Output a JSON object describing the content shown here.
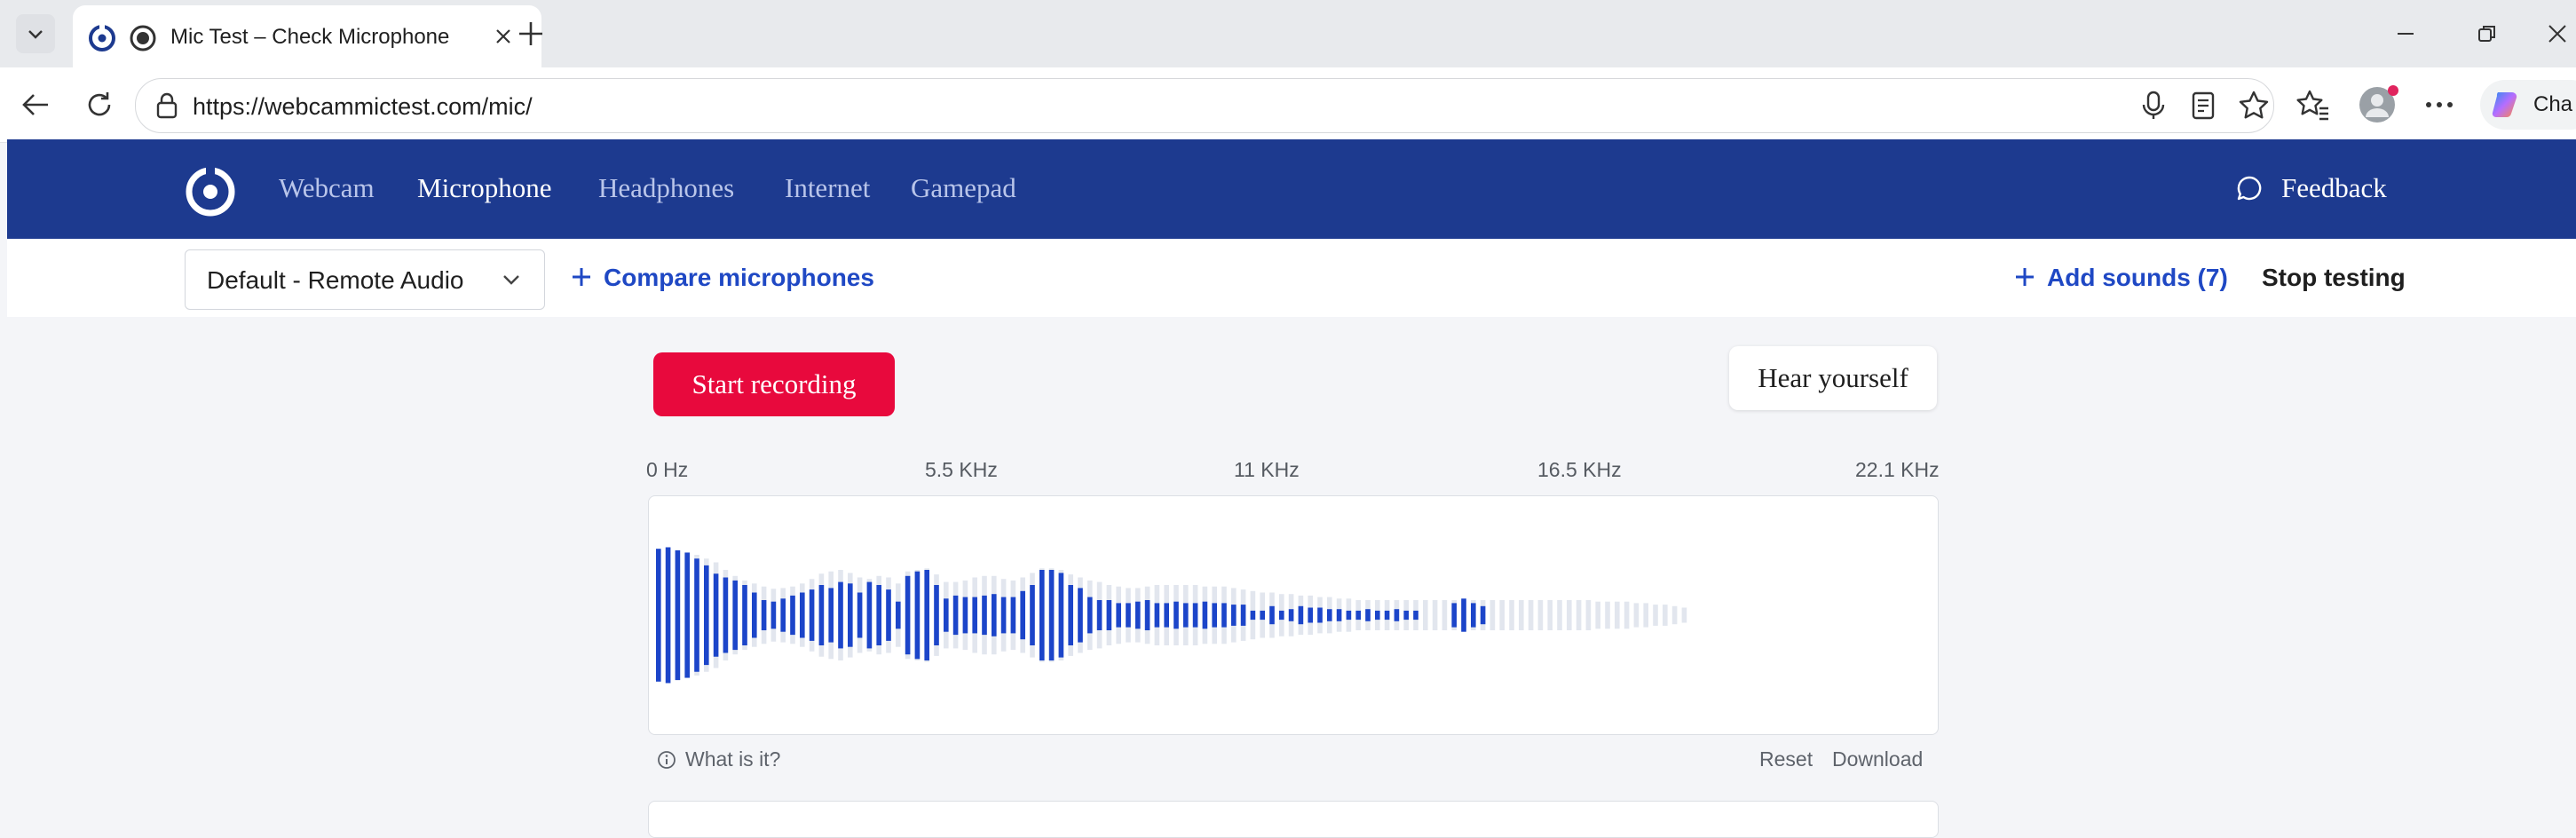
{
  "browser": {
    "tab_title": "Mic Test – Check Microphone",
    "url": "https://webcammictest.com/mic/",
    "copilot_label": "Cha"
  },
  "site": {
    "nav": [
      "Webcam",
      "Microphone",
      "Headphones",
      "Internet",
      "Gamepad"
    ],
    "active_nav": "Microphone",
    "feedback": "Feedback"
  },
  "toolbar": {
    "device": "Default - Remote Audio",
    "compare": "Compare microphones",
    "add_sounds": "Add sounds (7)",
    "stop": "Stop testing"
  },
  "main": {
    "record": "Start recording",
    "hear": "Hear yourself",
    "freq_ticks": [
      "0 Hz",
      "5.5 KHz",
      "11 KHz",
      "16.5 KHz",
      "22.1 KHz"
    ],
    "what_is_it": "What is it?",
    "reset": "Reset",
    "download": "Download"
  },
  "spectrum": {
    "active_color": "#1c45c9",
    "ghost_color": "#e2e6ee",
    "active": [
      0.88,
      0.9,
      0.86,
      0.83,
      0.75,
      0.66,
      0.55,
      0.5,
      0.46,
      0.4,
      0.3,
      0.2,
      0.18,
      0.22,
      0.26,
      0.3,
      0.34,
      0.4,
      0.36,
      0.44,
      0.42,
      0.3,
      0.44,
      0.4,
      0.34,
      0.18,
      0.52,
      0.58,
      0.6,
      0.4,
      0.22,
      0.26,
      0.24,
      0.24,
      0.26,
      0.28,
      0.24,
      0.24,
      0.32,
      0.4,
      0.6,
      0.6,
      0.56,
      0.4,
      0.36,
      0.24,
      0.2,
      0.2,
      0.16,
      0.16,
      0.18,
      0.2,
      0.16,
      0.16,
      0.18,
      0.16,
      0.16,
      0.18,
      0.16,
      0.16,
      0.14,
      0.14,
      0.06,
      0.06,
      0.12,
      0.06,
      0.08,
      0.12,
      0.1,
      0.1,
      0.08,
      0.08,
      0.06,
      0.06,
      0.08,
      0.06,
      0.06,
      0.08,
      0.06,
      0.06,
      0,
      0,
      0,
      0.16,
      0.22,
      0.16,
      0.12
    ],
    "ghost": [
      0.88,
      0.9,
      0.86,
      0.83,
      0.8,
      0.75,
      0.7,
      0.6,
      0.52,
      0.46,
      0.42,
      0.38,
      0.35,
      0.36,
      0.38,
      0.42,
      0.48,
      0.55,
      0.58,
      0.6,
      0.56,
      0.5,
      0.48,
      0.52,
      0.5,
      0.42,
      0.58,
      0.6,
      0.62,
      0.54,
      0.44,
      0.44,
      0.46,
      0.5,
      0.52,
      0.52,
      0.48,
      0.46,
      0.5,
      0.56,
      0.62,
      0.62,
      0.6,
      0.54,
      0.5,
      0.46,
      0.44,
      0.4,
      0.38,
      0.36,
      0.36,
      0.38,
      0.4,
      0.4,
      0.4,
      0.4,
      0.4,
      0.38,
      0.38,
      0.38,
      0.36,
      0.34,
      0.32,
      0.3,
      0.3,
      0.28,
      0.28,
      0.26,
      0.26,
      0.24,
      0.24,
      0.22,
      0.22,
      0.2,
      0.2,
      0.2,
      0.2,
      0.2,
      0.2,
      0.2,
      0.2,
      0.2,
      0.2,
      0.2,
      0.2,
      0.2,
      0.2,
      0.2,
      0.2,
      0.2,
      0.2,
      0.2,
      0.2,
      0.2,
      0.2,
      0.2,
      0.2,
      0.2,
      0.18,
      0.18,
      0.18,
      0.18,
      0.16,
      0.16,
      0.14,
      0.14,
      0.12,
      0.1
    ]
  }
}
